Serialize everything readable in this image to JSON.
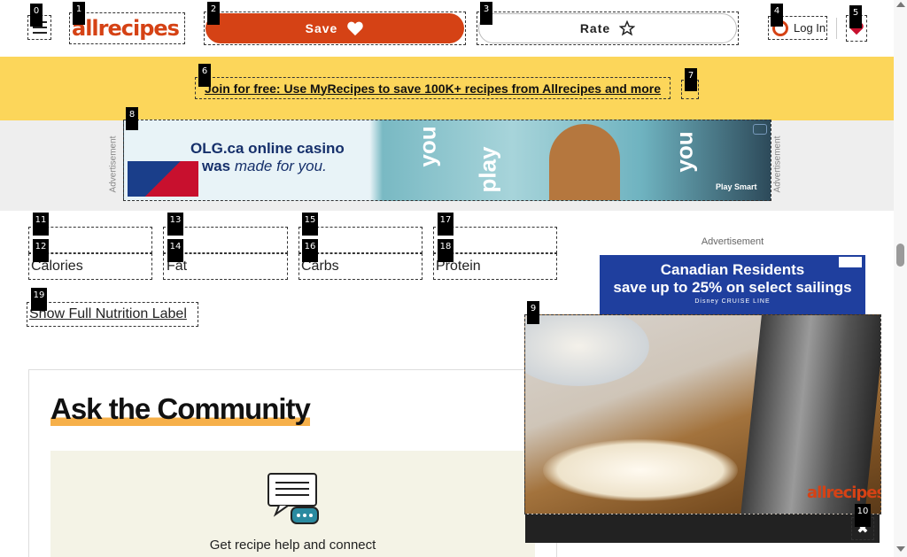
{
  "header": {
    "logo_text": "allrecipes",
    "save_label": "Save",
    "rate_label": "Rate",
    "login_label": "Log In"
  },
  "banner": {
    "link_text": "Join for free: Use MyRecipes to save 100K+ recipes from Allrecipes and more"
  },
  "top_ad": {
    "side_label": "Advertisement",
    "line1": "OLG.ca online casino",
    "line2_prefix": "was ",
    "line2_emphasis": "made for you.",
    "words": [
      "you",
      "play",
      "you"
    ],
    "footer": "Play Smart",
    "logo_text": "OLG"
  },
  "nutrition": {
    "items": [
      {
        "marker_top": "11",
        "marker_bottom": "12",
        "value": "",
        "label": "Calories"
      },
      {
        "marker_top": "13",
        "marker_bottom": "14",
        "value": "",
        "label": "Fat"
      },
      {
        "marker_top": "15",
        "marker_bottom": "16",
        "value": "",
        "label": "Carbs"
      },
      {
        "marker_top": "17",
        "marker_bottom": "18",
        "value": "",
        "label": "Protein"
      }
    ],
    "show_full_label": "Show Full Nutrition Label"
  },
  "community": {
    "title": "Ask the Community",
    "text": "Get recipe help and connect"
  },
  "right_ad": {
    "label": "Advertisement",
    "line1": "Canadian Residents",
    "line2": "save up to 25% on select sailings",
    "line3": "Disney CRUISE LINE"
  },
  "video": {
    "watermark": "allrecipes",
    "close_glyph": "✖"
  },
  "markers": [
    "0",
    "1",
    "2",
    "3",
    "4",
    "5",
    "6",
    "7",
    "8",
    "9",
    "10",
    "19"
  ],
  "colors": {
    "brand": "#d54215",
    "banner_bg": "#fcd65a",
    "ad_strip_bg": "#eeeeee",
    "community_box_bg": "#f4f3e6",
    "title_underline": "#f6b04a"
  }
}
